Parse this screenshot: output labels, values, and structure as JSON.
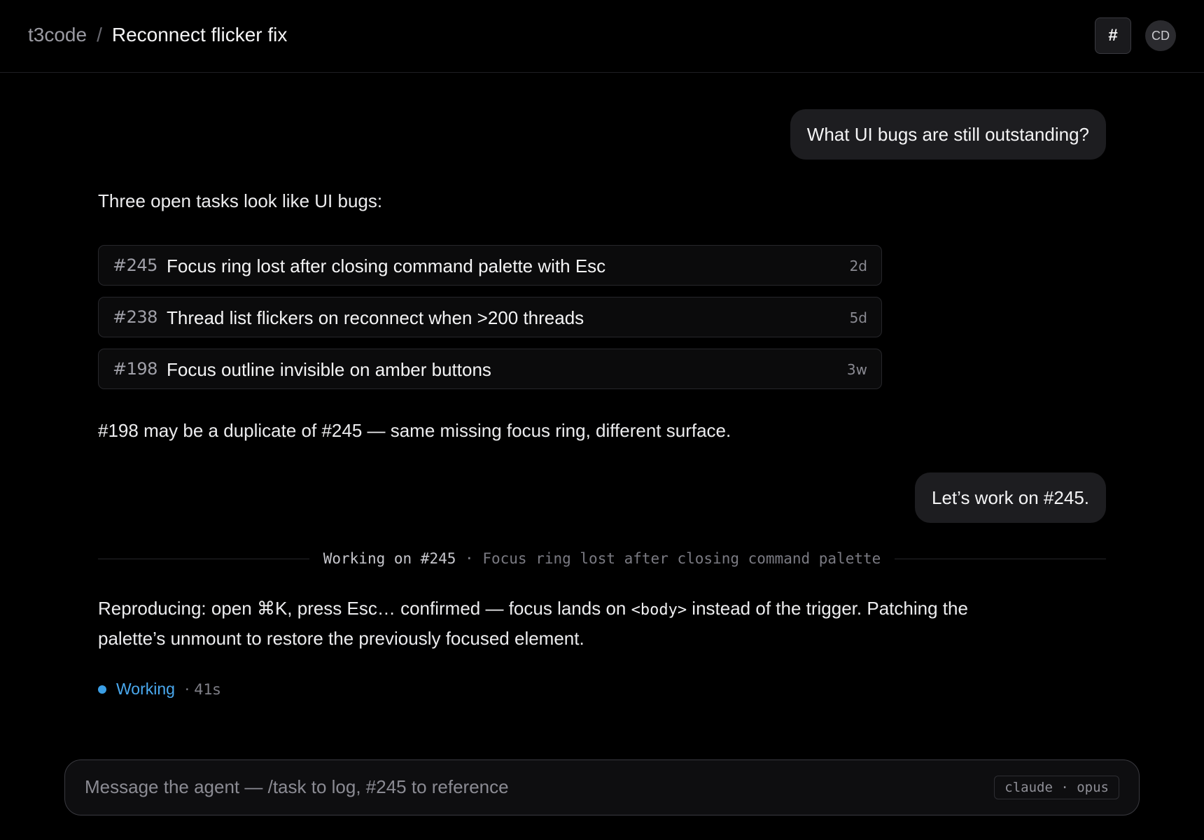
{
  "header": {
    "breadcrumb_root": "t3code",
    "breadcrumb_separator": "/",
    "thread_title": "Reconnect flicker fix",
    "hash_button_label": "#",
    "avatar_initials": "CD"
  },
  "messages": {
    "user_question": "What UI bugs are still outstanding?",
    "agent_intro": "Three open tasks look like UI bugs:",
    "tasks": [
      {
        "id": "#245",
        "title": "Focus ring lost after closing command palette with Esc",
        "age": "2d"
      },
      {
        "id": "#238",
        "title": "Thread list flickers on reconnect when >200 threads",
        "age": "5d"
      },
      {
        "id": "#198",
        "title": "Focus outline invisible on amber buttons",
        "age": "3w"
      }
    ],
    "agent_note": "#198 may be a duplicate of #245 — same missing focus ring, different surface.",
    "user_followup": "Let’s work on #245.",
    "divider": {
      "label": "Working on #245",
      "subtitle": "· Focus ring lost after closing command palette"
    },
    "repro": {
      "before_code": "Reproducing: open ⌘K, press Esc… confirmed — focus lands on ",
      "code": "<body>",
      "after_code": " instead of the trigger. Patching the palette’s unmount to restore the previously focused element."
    },
    "status": {
      "label": "Working",
      "elapsed": "· 41s",
      "color": "#3b9fe6"
    }
  },
  "composer": {
    "placeholder": "Message the agent — /task to log, #245 to reference",
    "value": "",
    "model_chip": "claude · opus"
  }
}
